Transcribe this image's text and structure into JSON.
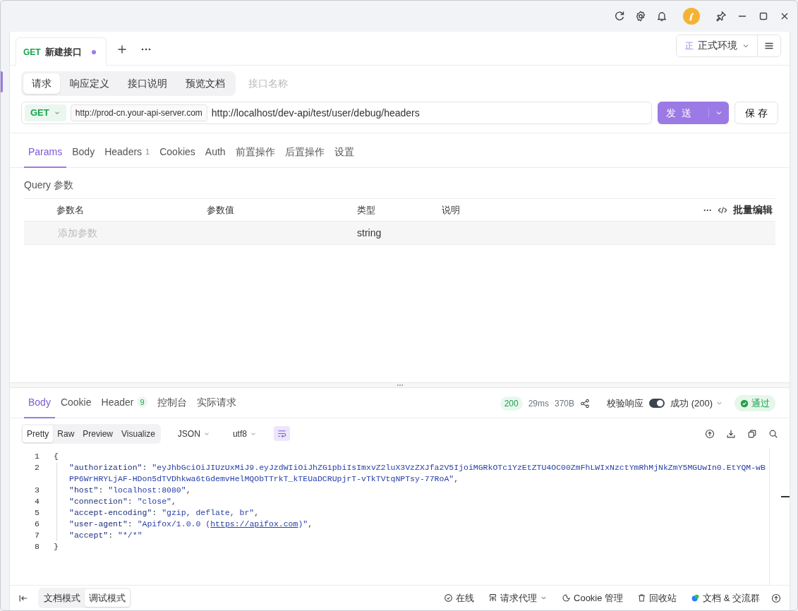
{
  "tabs": [
    {
      "method": "GET",
      "title": "新建接口",
      "selected": true,
      "unsaved": true
    }
  ],
  "environment": {
    "badge": "正",
    "name": "正式环境"
  },
  "mode_tabs": [
    {
      "label": "请求",
      "selected": true
    },
    {
      "label": "响应定义",
      "selected": false
    },
    {
      "label": "接口说明",
      "selected": false
    },
    {
      "label": "预览文档",
      "selected": false
    }
  ],
  "name_field": {
    "placeholder": "接口名称"
  },
  "request": {
    "method": "GET",
    "base_url": "http://prod-cn.your-api-server.com",
    "path": "http://localhost/dev-api/test/user/debug/headers",
    "send": "发 送",
    "save": "保 存"
  },
  "request_tabs": [
    {
      "label": "Params",
      "selected": true
    },
    {
      "label": "Body",
      "selected": false
    },
    {
      "label": "Headers",
      "count": "1",
      "selected": false
    },
    {
      "label": "Cookies",
      "selected": false
    },
    {
      "label": "Auth",
      "selected": false
    },
    {
      "label": "前置操作",
      "selected": false
    },
    {
      "label": "后置操作",
      "selected": false
    },
    {
      "label": "设置",
      "selected": false
    }
  ],
  "query": {
    "title": "Query 参数",
    "columns": [
      "参数名",
      "参数值",
      "类型",
      "说明"
    ],
    "more": "···",
    "batch_edit": "批量编辑",
    "new_row": {
      "placeholder": "添加参数",
      "type": "string"
    }
  },
  "response_tabs": [
    {
      "label": "Body",
      "selected": true
    },
    {
      "label": "Cookie",
      "selected": false
    },
    {
      "label": "Header",
      "count": "9",
      "selected": false
    },
    {
      "label": "控制台",
      "selected": false
    },
    {
      "label": "实际请求",
      "selected": false
    }
  ],
  "response_meta": {
    "status": "200",
    "time": "29ms",
    "size": "370B",
    "validate_label": "校验响应",
    "validate_on": true,
    "result": "成功 (200)",
    "verdict": "通过"
  },
  "view_modes": [
    {
      "label": "Pretty",
      "selected": true
    },
    {
      "label": "Raw",
      "selected": false
    },
    {
      "label": "Preview",
      "selected": false
    },
    {
      "label": "Visualize",
      "selected": false
    }
  ],
  "format": "JSON",
  "encoding": "utf8",
  "wrap_on": true,
  "code_lines": [
    {
      "number": "1",
      "parts": [
        {
          "kind": "punct",
          "text": "{"
        }
      ]
    },
    {
      "number": "2",
      "indent": true,
      "parts": [
        {
          "kind": "key",
          "text": "\"authorization\""
        },
        {
          "kind": "punct",
          "text": ": "
        },
        {
          "kind": "string",
          "text": "\"eyJhbGciOiJIUzUxMiJ9.eyJzdWIiOiJhZG1pbiIsImxvZ2luX3VzZXJfa2V5IjoiMGRkOTc1YzEtZTU4OC00ZmFhLWIxNzctYmRhMjNkZmY5MGUwIn0.EtYQM-wBPP6WrHRYLjAF-HDon5dTVDhkwa6tGdemvHelMQObTTrkT_kTEUaDCRUpjrT-vTkTVtqNPTsy-77RoA\""
        },
        {
          "kind": "punct",
          "text": ","
        }
      ]
    },
    {
      "number": "3",
      "indent": true,
      "parts": [
        {
          "kind": "key",
          "text": "\"host\""
        },
        {
          "kind": "punct",
          "text": ": "
        },
        {
          "kind": "string",
          "text": "\"localhost:8080\""
        },
        {
          "kind": "punct",
          "text": ","
        }
      ]
    },
    {
      "number": "4",
      "indent": true,
      "parts": [
        {
          "kind": "key",
          "text": "\"connection\""
        },
        {
          "kind": "punct",
          "text": ": "
        },
        {
          "kind": "string",
          "text": "\"close\""
        },
        {
          "kind": "punct",
          "text": ","
        }
      ]
    },
    {
      "number": "5",
      "indent": true,
      "parts": [
        {
          "kind": "key",
          "text": "\"accept-encoding\""
        },
        {
          "kind": "punct",
          "text": ": "
        },
        {
          "kind": "string",
          "text": "\"gzip, deflate, br\""
        },
        {
          "kind": "punct",
          "text": ","
        }
      ]
    },
    {
      "number": "6",
      "indent": true,
      "parts": [
        {
          "kind": "key",
          "text": "\"user-agent\""
        },
        {
          "kind": "punct",
          "text": ": "
        },
        {
          "kind": "string",
          "text": "\"Apifox/1.0.0 ("
        },
        {
          "kind": "link",
          "text": "https://apifox.com"
        },
        {
          "kind": "string",
          "text": ")\""
        },
        {
          "kind": "punct",
          "text": ","
        }
      ]
    },
    {
      "number": "7",
      "indent": true,
      "parts": [
        {
          "kind": "key",
          "text": "\"accept\""
        },
        {
          "kind": "punct",
          "text": ": "
        },
        {
          "kind": "string",
          "text": "\"*/*\""
        }
      ]
    },
    {
      "number": "8",
      "parts": [
        {
          "kind": "punct",
          "text": "}"
        }
      ]
    }
  ],
  "footer": {
    "modes": [
      {
        "label": "文档模式",
        "selected": false
      },
      {
        "label": "调试模式",
        "selected": true
      }
    ],
    "items": [
      {
        "kind": "online",
        "label": "在线"
      },
      {
        "kind": "proxy",
        "label": "请求代理"
      },
      {
        "kind": "cookie",
        "label": "Cookie 管理"
      },
      {
        "kind": "trash",
        "label": "回收站"
      },
      {
        "kind": "community",
        "label": "文档 & 交流群"
      }
    ]
  }
}
